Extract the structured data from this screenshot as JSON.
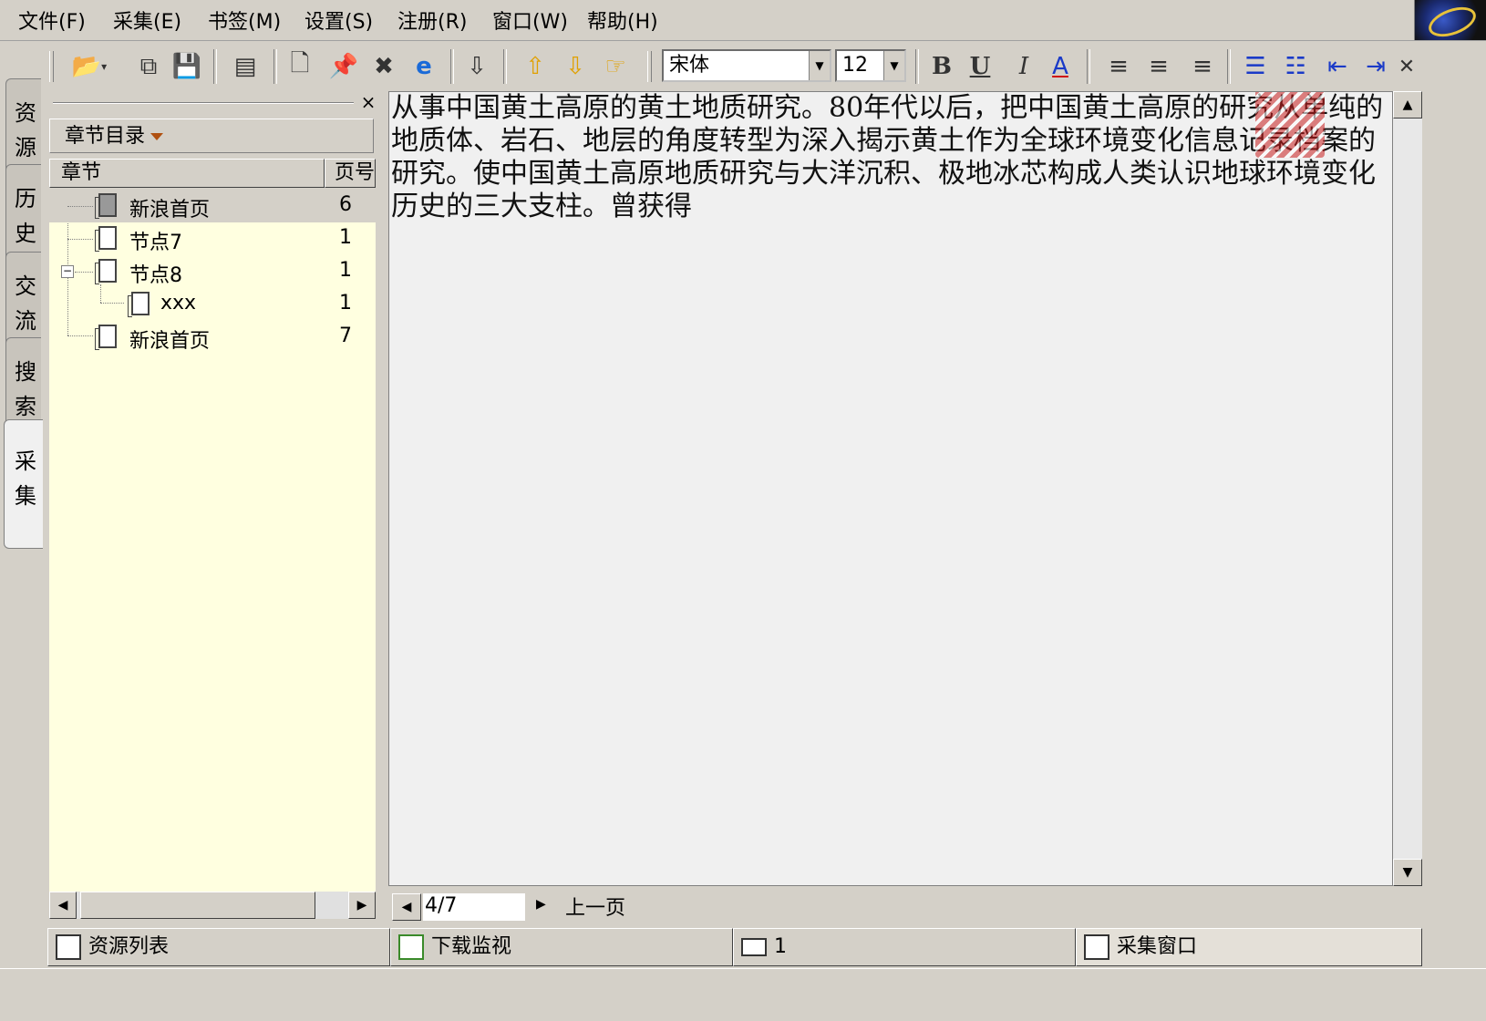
{
  "menu": {
    "items": [
      "文件(F)",
      "采集(E)",
      "书签(M)",
      "设置(S)",
      "注册(R)",
      "窗口(W)",
      "帮助(H)"
    ]
  },
  "toolbar": {
    "font_name": "宋体",
    "font_size": "12",
    "bold_label": "B",
    "underline_label": "U",
    "italic_label": "I",
    "font_color_label": "A",
    "close_label": "✕"
  },
  "vtabs": [
    "资源",
    "历史",
    "交流",
    "搜索",
    "采集"
  ],
  "left_panel": {
    "close_label": "×",
    "dropdown_label": "章节目录",
    "columns": [
      "章节",
      "页号"
    ],
    "rows": [
      {
        "label": "新浪首页",
        "page": "6",
        "level": 0
      },
      {
        "label": "节点7",
        "page": "1",
        "level": 0
      },
      {
        "label": "节点8",
        "page": "1",
        "level": 0
      },
      {
        "label": "xxx",
        "page": "1",
        "level": 1
      },
      {
        "label": "新浪首页",
        "page": "7",
        "level": 0
      }
    ]
  },
  "content": {
    "text": "从事中国黄土高原的黄土地质研究。80年代以后，把中国黄土高原的研究从单纯的地质体、岩石、地层的角度转型为深入揭示黄土作为全球环境变化信息记录档案的研究。使中国黄土高原地质研究与大洋沉积、极地冰芯构成人类认识地球环境变化历史的三大支柱。曾获得"
  },
  "pagenav": {
    "page_value": "4/7",
    "prev_label": "上一页"
  },
  "taskbar": {
    "tabs": [
      "资源列表",
      "下载监视",
      "1",
      "采集窗口"
    ]
  },
  "colors": {
    "chrome": "#d4d0c8",
    "tree_bg": "#ffffe0",
    "content_bg": "#f0f0f0"
  }
}
